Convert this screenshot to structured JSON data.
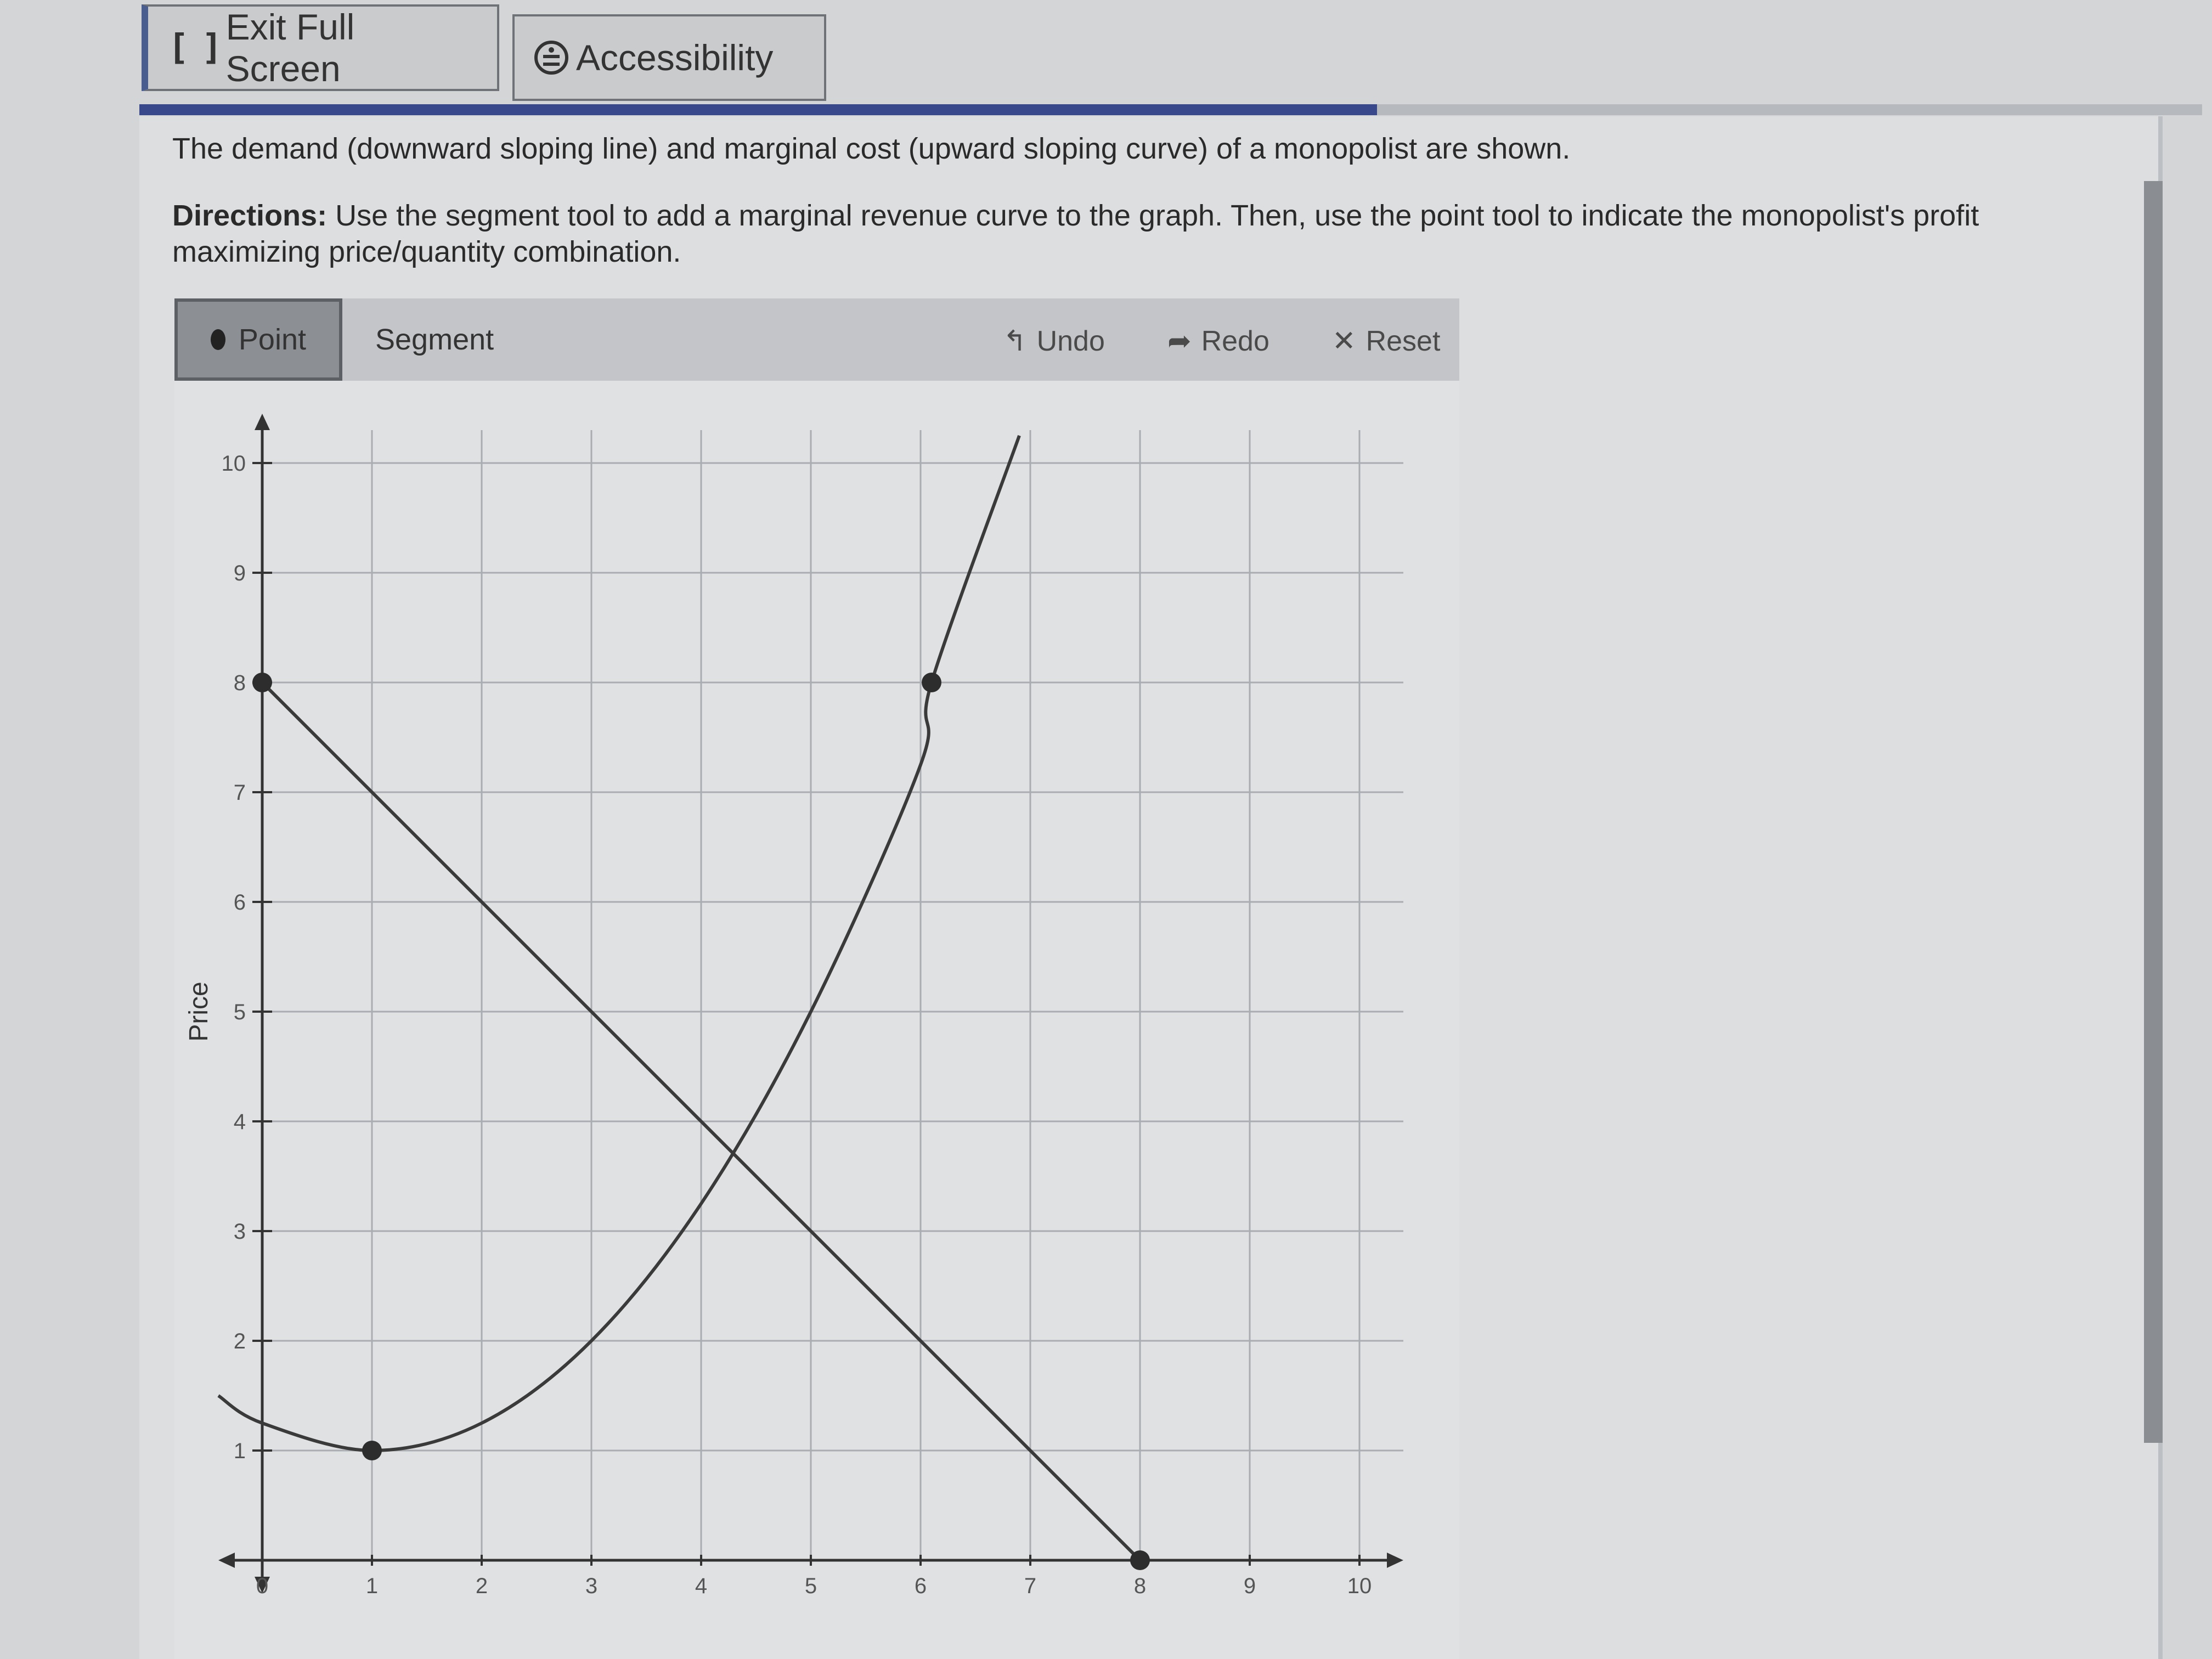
{
  "header": {
    "exit_label": "Exit Full Screen",
    "accessibility_label": "Accessibility"
  },
  "progress": {
    "fraction": 0.6
  },
  "question": {
    "prompt": "The demand (downward sloping line) and marginal cost (upward sloping curve) of a monopolist are shown.",
    "directions_label": "Directions:",
    "directions_text": "Use the segment tool to add a marginal revenue curve to the graph. Then, use the point tool to indicate the monopolist's profit maximizing price/quantity combination."
  },
  "toolbar": {
    "point_label": "Point",
    "segment_label": "Segment",
    "undo_label": "Undo",
    "redo_label": "Redo",
    "reset_label": "Reset"
  },
  "chart_data": {
    "type": "line",
    "ylabel": "Price",
    "xlabel": "",
    "xlim": [
      0,
      10
    ],
    "ylim": [
      0,
      10
    ],
    "x_ticks": [
      0,
      1,
      2,
      3,
      4,
      5,
      6,
      7,
      8,
      9,
      10
    ],
    "y_ticks": [
      1,
      2,
      3,
      4,
      5,
      6,
      7,
      8,
      9,
      10
    ],
    "grid": true,
    "series": [
      {
        "points": [
          [
            0,
            8
          ],
          [
            8,
            0
          ]
        ],
        "markers": [
          [
            0,
            8
          ],
          [
            8,
            0
          ]
        ]
      },
      {
        "points": [
          [
            -0.4,
            1.5
          ],
          [
            0,
            1.25
          ],
          [
            1,
            1
          ],
          [
            2,
            1.25
          ],
          [
            3,
            2
          ],
          [
            4,
            3.25
          ],
          [
            5,
            5
          ],
          [
            6,
            7.25
          ],
          [
            6.1,
            8
          ],
          [
            6.9,
            10.25
          ]
        ],
        "markers": [
          [
            1,
            1
          ],
          [
            6.1,
            8
          ]
        ]
      }
    ]
  }
}
